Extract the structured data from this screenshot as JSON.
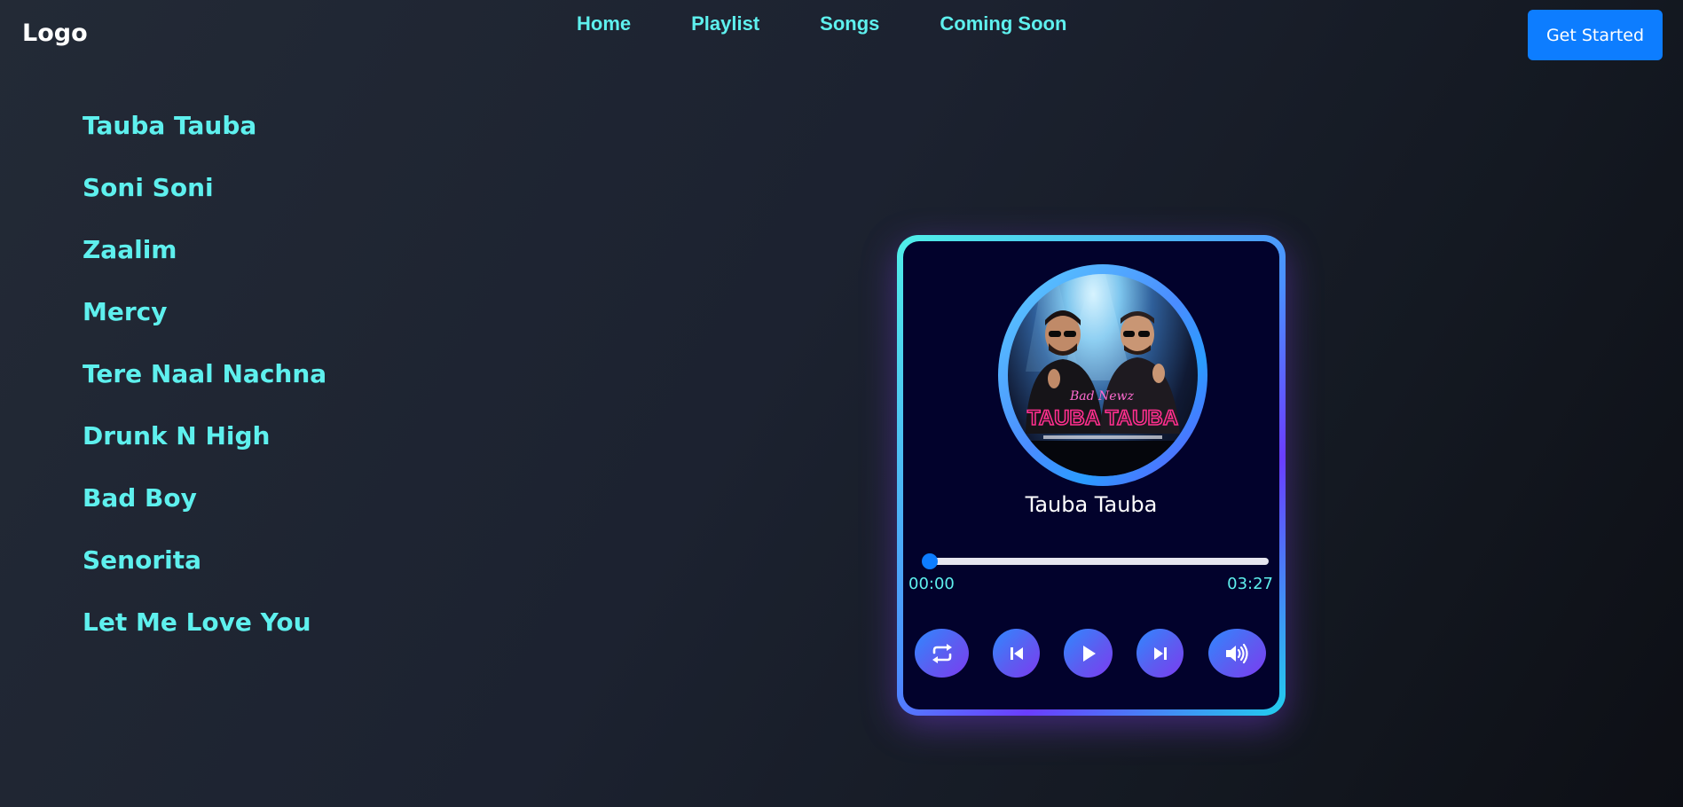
{
  "navbar": {
    "logo": "Logo",
    "links": [
      "Home",
      "Playlist",
      "Songs",
      "Coming Soon"
    ],
    "cta_label": "Get Started"
  },
  "playlist": {
    "songs": [
      "Tauba Tauba",
      "Soni Soni",
      "Zaalim",
      "Mercy",
      "Tere Naal Nachna",
      "Drunk N High",
      "Bad Boy",
      "Senorita",
      "Let Me Love You"
    ]
  },
  "player": {
    "track_title": "Tauba Tauba",
    "album_art_text": "TAUBA TAUBA",
    "album_art_script": "Bad Newz",
    "current_time": "00:00",
    "total_time": "03:27",
    "progress_fraction": 0.0,
    "controls": {
      "repeat": "repeat-icon",
      "previous": "skip-previous-icon",
      "play": "play-icon",
      "next": "skip-next-icon",
      "volume": "volume-icon"
    }
  },
  "colors": {
    "accent_cyan": "#5ef0ee",
    "button_blue": "#0d7dff",
    "player_bg": "#02022c",
    "neon_pink": "#ff2f8e"
  }
}
